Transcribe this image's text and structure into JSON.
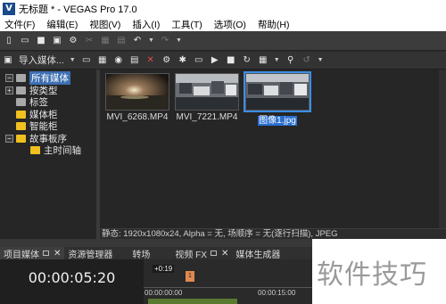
{
  "window": {
    "title": "无标题 * - VEGAS Pro 17.0",
    "logo_letter": "V"
  },
  "menu": [
    "文件(F)",
    "编辑(E)",
    "视图(V)",
    "插入(I)",
    "工具(T)",
    "选项(O)",
    "帮助(H)"
  ],
  "explorer_toolbar": {
    "import_label": "导入媒体..."
  },
  "tree": {
    "items": [
      {
        "label": "所有媒体",
        "expander": "−"
      },
      {
        "label": "按类型",
        "expander": "+"
      },
      {
        "label": "标签",
        "expander": ""
      },
      {
        "label": "媒体柜",
        "expander": ""
      },
      {
        "label": "智能柜",
        "expander": ""
      },
      {
        "label": "故事板序",
        "expander": "−"
      },
      {
        "label": "主时间轴",
        "expander": ""
      }
    ]
  },
  "media": {
    "items": [
      {
        "name": "MVI_6268.MP4"
      },
      {
        "name": "MVI_7221.MP4"
      },
      {
        "name": "图像1.jpg"
      }
    ]
  },
  "status": {
    "text": "静态: 1920x1080x24, Alpha = 无, 场顺序 = 无(逐行扫描), JPEG"
  },
  "tabs": [
    "项目媒体",
    "资源管理器",
    "转场",
    "视频 FX",
    "媒体生成器"
  ],
  "timeline": {
    "timecode": "00:00:05:20",
    "offset": "+0:19",
    "marker": "1",
    "ruler": [
      "00:00:00:00",
      "00:00:15:00"
    ]
  },
  "watermark": "软件技巧"
}
